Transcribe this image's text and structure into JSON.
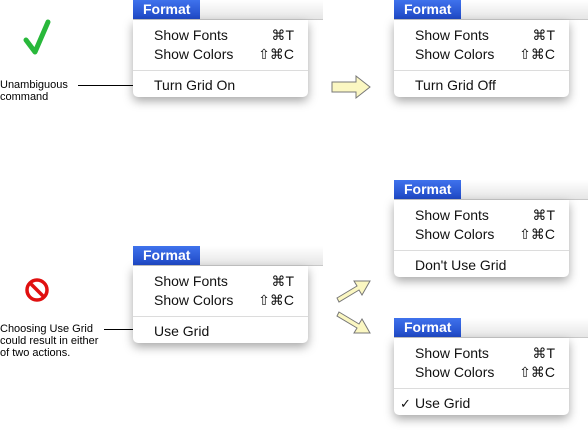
{
  "menu_title": "Format",
  "items": {
    "show_fonts": "Show Fonts",
    "show_fonts_shortcut": "⌘T",
    "show_colors": "Show Colors",
    "show_colors_shortcut": "⇧⌘C",
    "turn_grid_on": "Turn Grid On",
    "turn_grid_off": "Turn Grid Off",
    "use_grid": "Use Grid",
    "dont_use_grid": "Don't Use Grid",
    "checkmark": "✓"
  },
  "captions": {
    "unambiguous": "Unambiguous\ncommand",
    "ambiguous": "Choosing Use Grid\ncould result in either\nof two actions."
  },
  "icons": {
    "good": "checkmark-icon",
    "bad": "prohibited-icon",
    "good_color": "#28b83a",
    "bad_color": "#e01010",
    "arrow_fill": "#fbf7c2"
  }
}
